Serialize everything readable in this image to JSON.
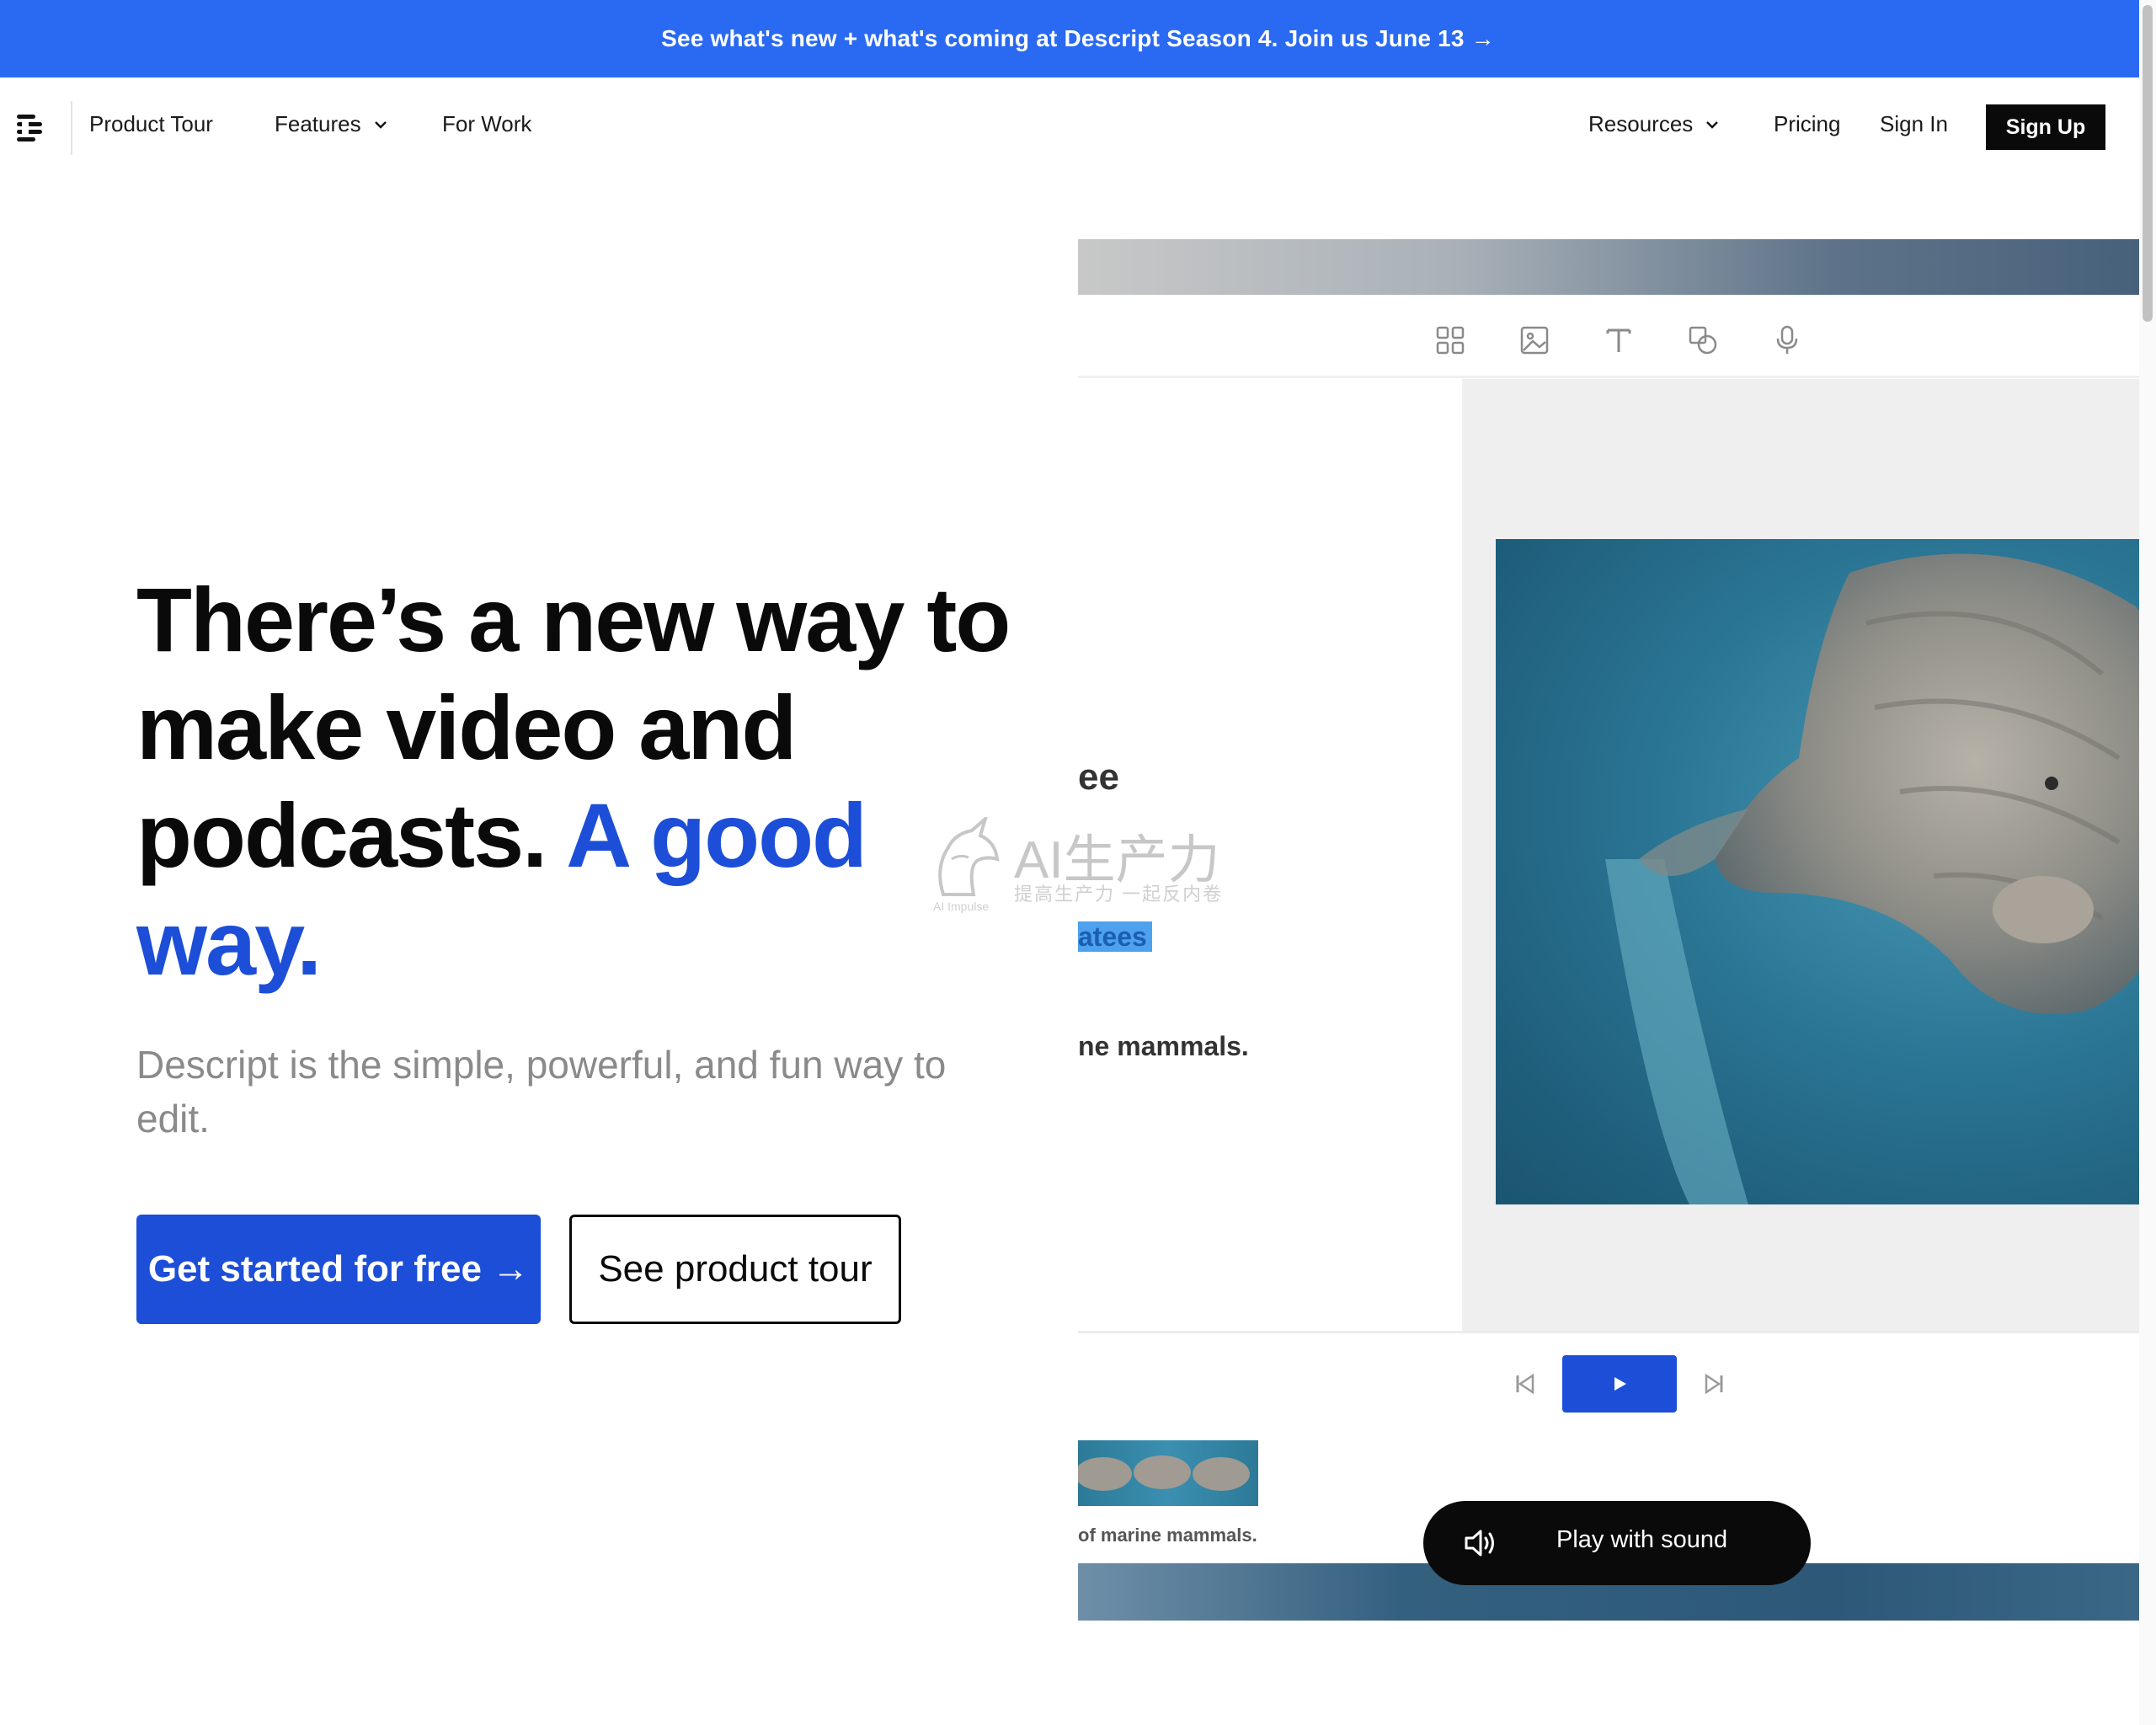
{
  "announcement": {
    "text": "See what's new + what's coming at Descript Season 4. Join us June 13 →"
  },
  "nav": {
    "logo": "descript-logo-icon",
    "left_links": [
      "Product Tour",
      "Features",
      "For Work"
    ],
    "right_links": [
      "Resources",
      "Pricing",
      "Sign In"
    ],
    "signup_label": "Sign Up"
  },
  "hero": {
    "title_main": "There’s a new way to make video and podcasts.",
    "title_accent": "A good way.",
    "subtitle": "Descript is the simple, powerful, and fun way to edit.",
    "primary_cta": "Get started for free →",
    "secondary_cta": "See product tour"
  },
  "preview": {
    "toolbar_icons": [
      "grid-icon",
      "image-icon",
      "text-icon",
      "shapes-icon",
      "microphone-icon"
    ],
    "script_lines": [
      "ee",
      "atees",
      "ne mammals."
    ],
    "timeline_caption": "of marine mammals.",
    "play_with_sound": "Play with sound"
  },
  "watermark": {
    "main": "AI生产力",
    "sub": "提高生产力 一起反内卷",
    "small": "AI Impulse"
  },
  "colors": {
    "accent": "#1c4ed8",
    "announcement_bg": "#2a6af2",
    "button_dark": "#0a0a0a"
  }
}
